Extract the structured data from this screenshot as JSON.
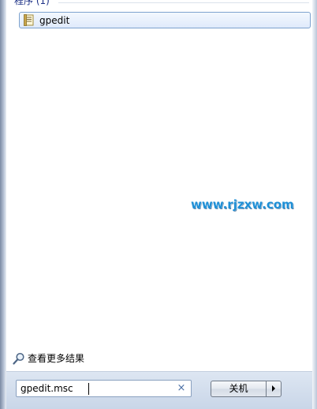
{
  "start_menu": {
    "group_header": "程序 (1)",
    "results": [
      {
        "label": "gpedit",
        "icon": "policy-document-icon"
      }
    ],
    "watermark": "www.rjzxw.com",
    "more_results": {
      "label": "查看更多结果",
      "icon": "magnifier-icon"
    },
    "search": {
      "value": "gpedit.msc",
      "clear_icon": "×"
    },
    "shutdown": {
      "label": "关机",
      "arrow_icon": "triangle-right-icon"
    }
  },
  "colors": {
    "header_text": "#1e3287",
    "selection_border": "#7da2ce",
    "watermark": "#1e8fd6",
    "bottom_bar": "#c9d6e8"
  }
}
